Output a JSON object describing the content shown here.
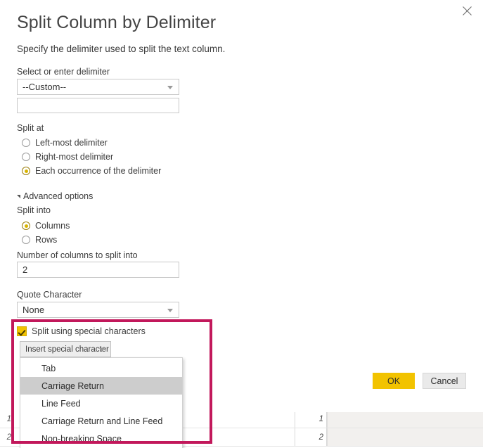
{
  "dialog": {
    "title": "Split Column by Delimiter",
    "subtitle": "Specify the delimiter used to split the text column.",
    "close_label": "close-icon"
  },
  "delimiter": {
    "label": "Select or enter delimiter",
    "selected": "--Custom--",
    "custom_value": "",
    "custom_placeholder": ""
  },
  "split_at": {
    "label": "Split at",
    "options": [
      {
        "label": "Left-most delimiter",
        "selected": false
      },
      {
        "label": "Right-most delimiter",
        "selected": false
      },
      {
        "label": "Each occurrence of the delimiter",
        "selected": true
      }
    ]
  },
  "advanced": {
    "toggle_label": "Advanced options",
    "expanded": true,
    "split_into": {
      "label": "Split into",
      "options": [
        {
          "label": "Columns",
          "selected": true
        },
        {
          "label": "Rows",
          "selected": false
        }
      ]
    },
    "num_columns": {
      "label": "Number of columns to split into",
      "value": "2"
    },
    "quote_character": {
      "label": "Quote Character",
      "selected": "None"
    },
    "special_characters": {
      "checkbox_label": "Split using special characters",
      "checked": true,
      "button_label": "Insert special character",
      "menu_items": [
        {
          "label": "Tab",
          "highlighted": false
        },
        {
          "label": "Carriage Return",
          "highlighted": true
        },
        {
          "label": "Line Feed",
          "highlighted": false
        },
        {
          "label": "Carriage Return and Line Feed",
          "highlighted": false
        },
        {
          "label": "Non-breaking Space",
          "highlighted": false
        }
      ]
    }
  },
  "footer": {
    "ok_label": "OK",
    "cancel_label": "Cancel"
  },
  "background_grid": {
    "rows": [
      {
        "row_number": "1",
        "value": "1"
      },
      {
        "row_number": "2",
        "value": "2"
      }
    ]
  },
  "colors": {
    "accent": "#f2c300",
    "annotation": "#c2185b",
    "highlight": "#cdcdcd"
  }
}
